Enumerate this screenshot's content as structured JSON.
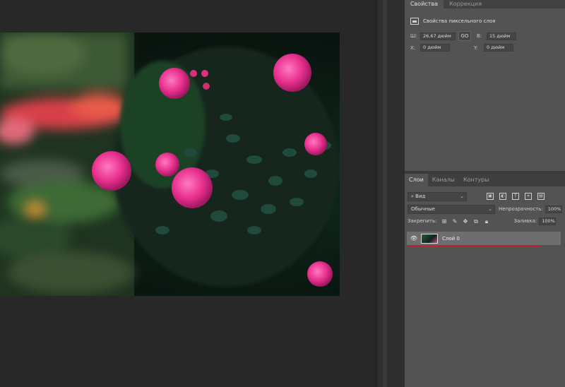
{
  "properties_panel": {
    "tabs": [
      "Свойства",
      "Коррекция"
    ],
    "header": "Свойства пиксельного слоя",
    "width_label": "Ш:",
    "width_value": "26,67 дюйм",
    "link_label": "GO",
    "height_label": "В:",
    "height_value": "15 дюйм",
    "x_label": "X:",
    "x_value": "0 дюйм",
    "y_label": "Y:",
    "y_value": "0 дюйм"
  },
  "layers_panel": {
    "tabs": [
      "Слои",
      "Каналы",
      "Контуры"
    ],
    "filter_value": "Вид",
    "blend_mode": "Обычные",
    "opacity_label": "Непрозрачность:",
    "opacity_value": "100%",
    "lock_label": "Закрепить:",
    "fill_label": "Заливка:",
    "fill_value": "100%",
    "layer_name": "Слой 0"
  },
  "icons": {
    "filter_icons": [
      "image-icon",
      "adjustment-icon",
      "type-icon",
      "shape-icon",
      "smart-object-icon"
    ],
    "lock_icons": [
      "lock-pixels-icon",
      "lock-paint-icon",
      "lock-move-icon",
      "lock-artboard-icon",
      "lock-all-icon"
    ]
  },
  "colors": {
    "panel_bg": "#535353",
    "selected_layer_bg": "#6e6e6e",
    "highlight_underline": "#c0242a"
  }
}
